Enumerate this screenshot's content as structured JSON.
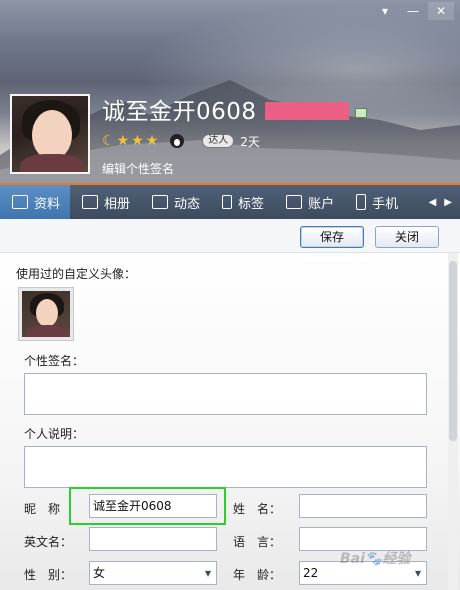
{
  "window": {
    "controls": [
      "▾",
      "—",
      "✕"
    ]
  },
  "profile": {
    "nickname": "诚至金开0608",
    "days_label": "2天",
    "daren_label": "达人",
    "edit_signature": "编辑个性签名"
  },
  "tabs": [
    {
      "label": "资料"
    },
    {
      "label": "相册"
    },
    {
      "label": "动态"
    },
    {
      "label": "标签"
    },
    {
      "label": "账户"
    },
    {
      "label": "手机"
    }
  ],
  "toolbar": {
    "save": "保存",
    "close": "关闭"
  },
  "form": {
    "used_avatars_label": "使用过的自定义头像：",
    "signature_label": "个性签名：",
    "description_label": "个人说明：",
    "nickname_label": "昵　称",
    "nickname_value": "诚至金开0608",
    "surname_label": "姓　名：",
    "english_name_label": "英文名：",
    "language_label": "语　言：",
    "gender_label": "性　别：",
    "gender_value": "女",
    "age_label": "年　龄：",
    "age_value": "22"
  },
  "watermark": "Bai🐾经验",
  "colors": {
    "accent": "#e8772a",
    "highlight": "#2fce2f",
    "pink": "#ec5f84"
  }
}
